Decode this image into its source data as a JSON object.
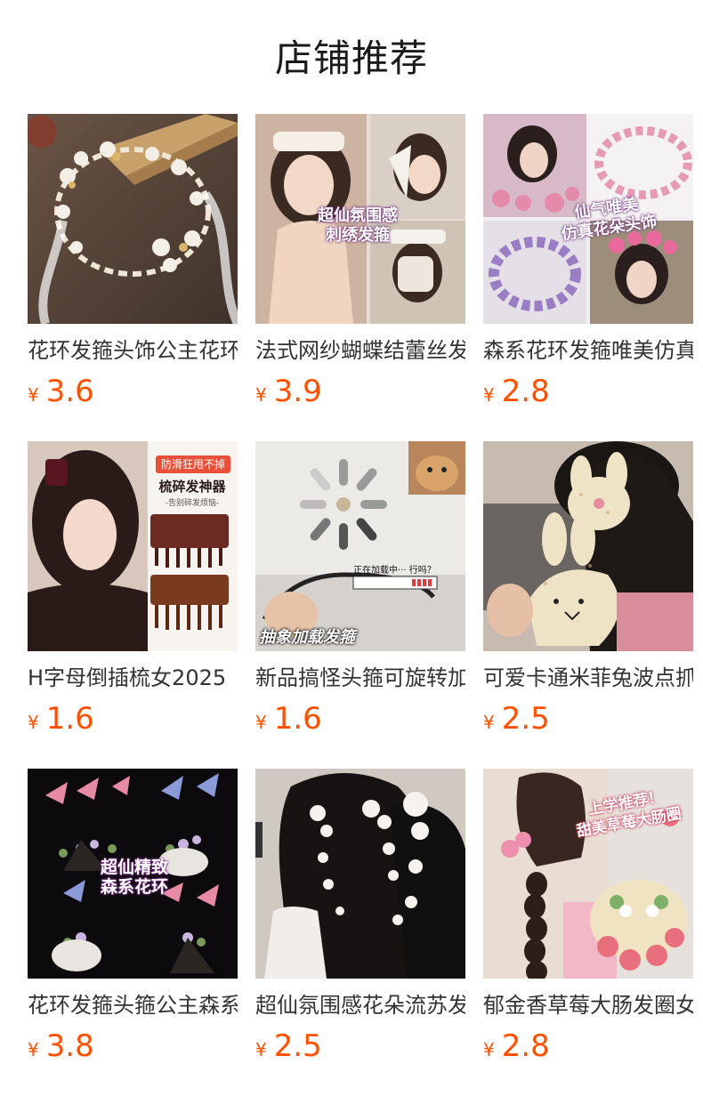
{
  "section": {
    "title": "店铺推荐"
  },
  "products": [
    {
      "name": "花环发箍头饰公主花环",
      "currency": "¥",
      "price": "3.6",
      "overlay": []
    },
    {
      "name": "法式网纱蝴蝶结蕾丝发箍",
      "currency": "¥",
      "price": "3.9",
      "overlay": [
        "超仙氛围感",
        "刺绣发箍"
      ]
    },
    {
      "name": "森系花环发箍唯美仿真花",
      "currency": "¥",
      "price": "2.8",
      "overlay": [
        "仙气唯美",
        "仿真花朵头饰"
      ]
    },
    {
      "name": "H字母倒插梳女2025",
      "currency": "¥",
      "price": "1.6",
      "overlay": [
        "防滑狂甩不掉",
        "梳碎发神器",
        "-告别碎发烦恼-"
      ]
    },
    {
      "name": "新品搞怪头箍可旋转加载",
      "currency": "¥",
      "price": "1.6",
      "overlay": [
        "抽象加载发箍",
        "正在加载中···",
        "行吗？"
      ]
    },
    {
      "name": "可爱卡通米菲兔波点抓夹",
      "currency": "¥",
      "price": "2.5",
      "overlay": []
    },
    {
      "name": "花环发箍头箍公主森系",
      "currency": "¥",
      "price": "3.8",
      "overlay": [
        "超仙精致",
        "森系花环"
      ]
    },
    {
      "name": "超仙氛围感花朵流苏发夹",
      "currency": "¥",
      "price": "2.5",
      "overlay": []
    },
    {
      "name": "郁金香草莓大肠发圈女",
      "currency": "¥",
      "price": "2.8",
      "overlay": [
        "上学推荐！",
        "甜美草莓大肠圈"
      ]
    }
  ],
  "colors": {
    "accent_price": "#ff5000",
    "title_text": "#1a1a1a"
  }
}
